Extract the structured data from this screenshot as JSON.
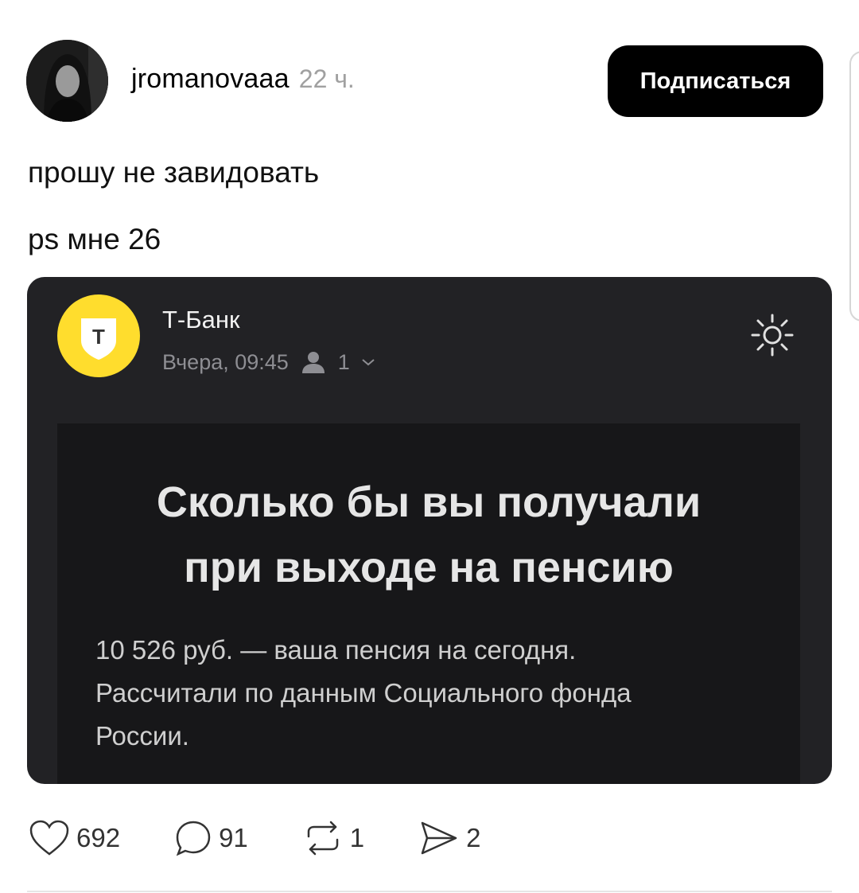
{
  "post": {
    "username": "jromanovaaa",
    "time": "22 ч.",
    "subscribe_label": "Подписаться",
    "text_line1": "прошу не завидовать",
    "text_line2": "ps мне 26"
  },
  "embedded_email": {
    "logo_letter": "Т",
    "sender": "Т-Банк",
    "date": "Вчера, 09:45",
    "recipients_count": "1",
    "title_line1": "Сколько бы вы получали",
    "title_line2": "при выходе на пенсию",
    "body_line1": "10 526 руб. — ваша пенсия на сегодня.",
    "body_line2": "Рассчитали по данным Социального фонда",
    "body_line3": "России."
  },
  "actions": {
    "likes": "692",
    "comments": "91",
    "reposts": "1",
    "shares": "2"
  },
  "colors": {
    "subscribe_bg": "#000000",
    "card_bg": "#222225",
    "bank_yellow": "#ffdd2d"
  },
  "icons": [
    "avatar-photo",
    "tbank-shield-logo",
    "person-icon",
    "chevron-down-icon",
    "sun-icon",
    "heart-icon",
    "comment-icon",
    "repost-icon",
    "share-icon"
  ]
}
